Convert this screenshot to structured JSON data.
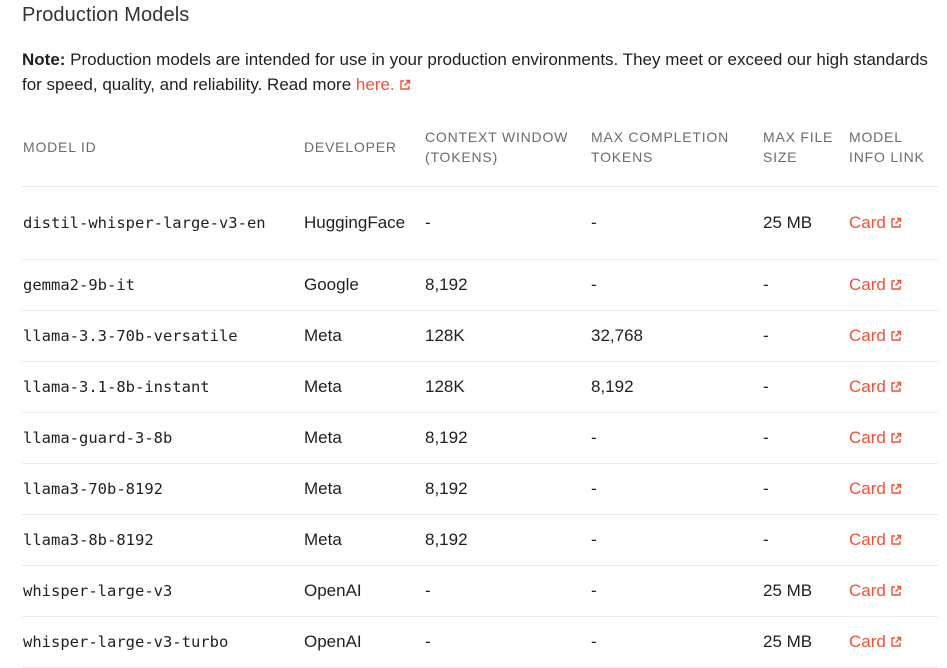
{
  "heading": "Production Models",
  "note": {
    "label": "Note:",
    "text": " Production models are intended for use in your production environments. They meet or exceed our high standards for speed, quality, and reliability. Read more ",
    "link": "here."
  },
  "table": {
    "headers": {
      "model_id": "MODEL ID",
      "developer": "DEVELOPER",
      "context_window": "CONTEXT WINDOW (TOKENS)",
      "max_completion": "MAX COMPLETION TOKENS",
      "max_file_size": "MAX FILE SIZE",
      "info_link": "MODEL INFO LINK"
    },
    "rows": [
      {
        "model_id": "distil-whisper-large-v3-en",
        "developer": "HuggingFace",
        "context": "-",
        "max_completion": "-",
        "file_size": "25 MB",
        "link": "Card"
      },
      {
        "model_id": "gemma2-9b-it",
        "developer": "Google",
        "context": "8,192",
        "max_completion": "-",
        "file_size": "-",
        "link": "Card"
      },
      {
        "model_id": "llama-3.3-70b-versatile",
        "developer": "Meta",
        "context": "128K",
        "max_completion": "32,768",
        "file_size": "-",
        "link": "Card"
      },
      {
        "model_id": "llama-3.1-8b-instant",
        "developer": "Meta",
        "context": "128K",
        "max_completion": "8,192",
        "file_size": "-",
        "link": "Card"
      },
      {
        "model_id": "llama-guard-3-8b",
        "developer": "Meta",
        "context": "8,192",
        "max_completion": "-",
        "file_size": "-",
        "link": "Card"
      },
      {
        "model_id": "llama3-70b-8192",
        "developer": "Meta",
        "context": "8,192",
        "max_completion": "-",
        "file_size": "-",
        "link": "Card"
      },
      {
        "model_id": "llama3-8b-8192",
        "developer": "Meta",
        "context": "8,192",
        "max_completion": "-",
        "file_size": "-",
        "link": "Card"
      },
      {
        "model_id": "whisper-large-v3",
        "developer": "OpenAI",
        "context": "-",
        "max_completion": "-",
        "file_size": "25 MB",
        "link": "Card"
      },
      {
        "model_id": "whisper-large-v3-turbo",
        "developer": "OpenAI",
        "context": "-",
        "max_completion": "-",
        "file_size": "25 MB",
        "link": "Card"
      }
    ]
  },
  "colors": {
    "accent": "#f55036",
    "header_text": "#6b6b6b",
    "row_border": "#ececec"
  },
  "icons": {
    "external_link": "external-link-icon"
  }
}
